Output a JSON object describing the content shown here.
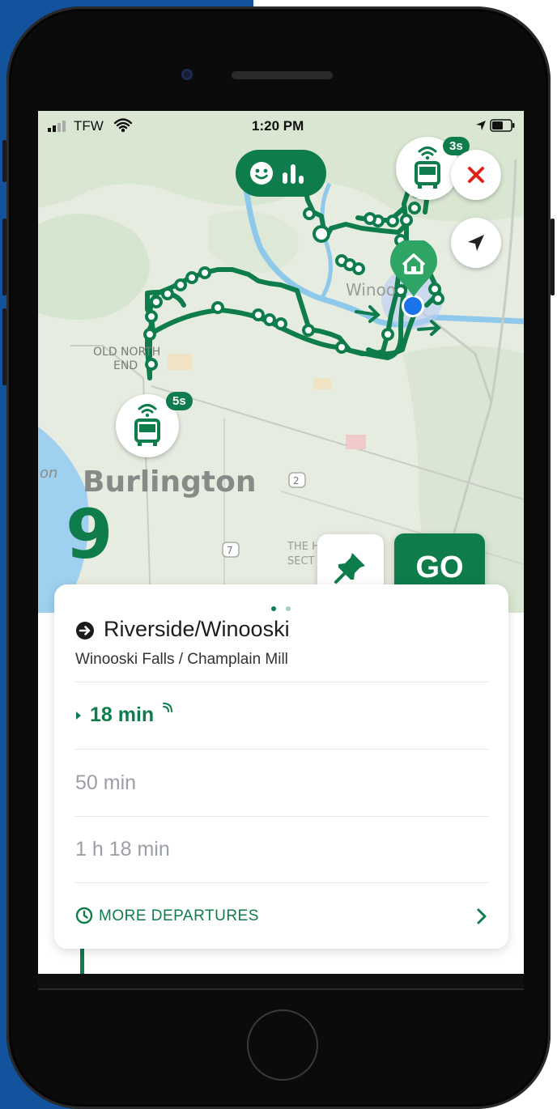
{
  "status_bar": {
    "carrier": "TFW",
    "time": "1:20 PM"
  },
  "map": {
    "labels": {
      "old_north_end_1": "OLD NORTH",
      "old_north_end_2": "END",
      "burlington": "Burlington",
      "winooski": "Winoo",
      "edge_label": "on",
      "the_hill_1": "THE H",
      "the_hill_2": "SECT",
      "shield_2": "2",
      "shield_7": "7"
    },
    "bus_markers": [
      {
        "time": "3s"
      },
      {
        "time": "5s"
      }
    ],
    "route_number": "9"
  },
  "buttons": {
    "go": "GO"
  },
  "card": {
    "route_name": "Riverside/Winooski",
    "stop_name": "Winooski Falls / Champlain Mill",
    "departures": [
      {
        "time": "18 min",
        "live": true
      },
      {
        "time": "50 min",
        "live": false
      },
      {
        "time": "1 h 18 min",
        "live": false
      }
    ],
    "more_departures": "MORE DEPARTURES"
  },
  "colors": {
    "brand_green": "#0f7d4b",
    "close_red": "#e0201b",
    "user_blue": "#1a73e8",
    "muted_text": "#9a9ea5"
  },
  "icons": [
    "signal-icon",
    "wifi-icon",
    "location-arrow-icon",
    "battery-icon",
    "smile-icon",
    "bar-chart-icon",
    "bus-icon",
    "close-icon",
    "locate-icon",
    "home-icon",
    "pin-icon",
    "arrow-circle-icon",
    "realtime-icon",
    "clock-icon",
    "chevron-right-icon"
  ]
}
